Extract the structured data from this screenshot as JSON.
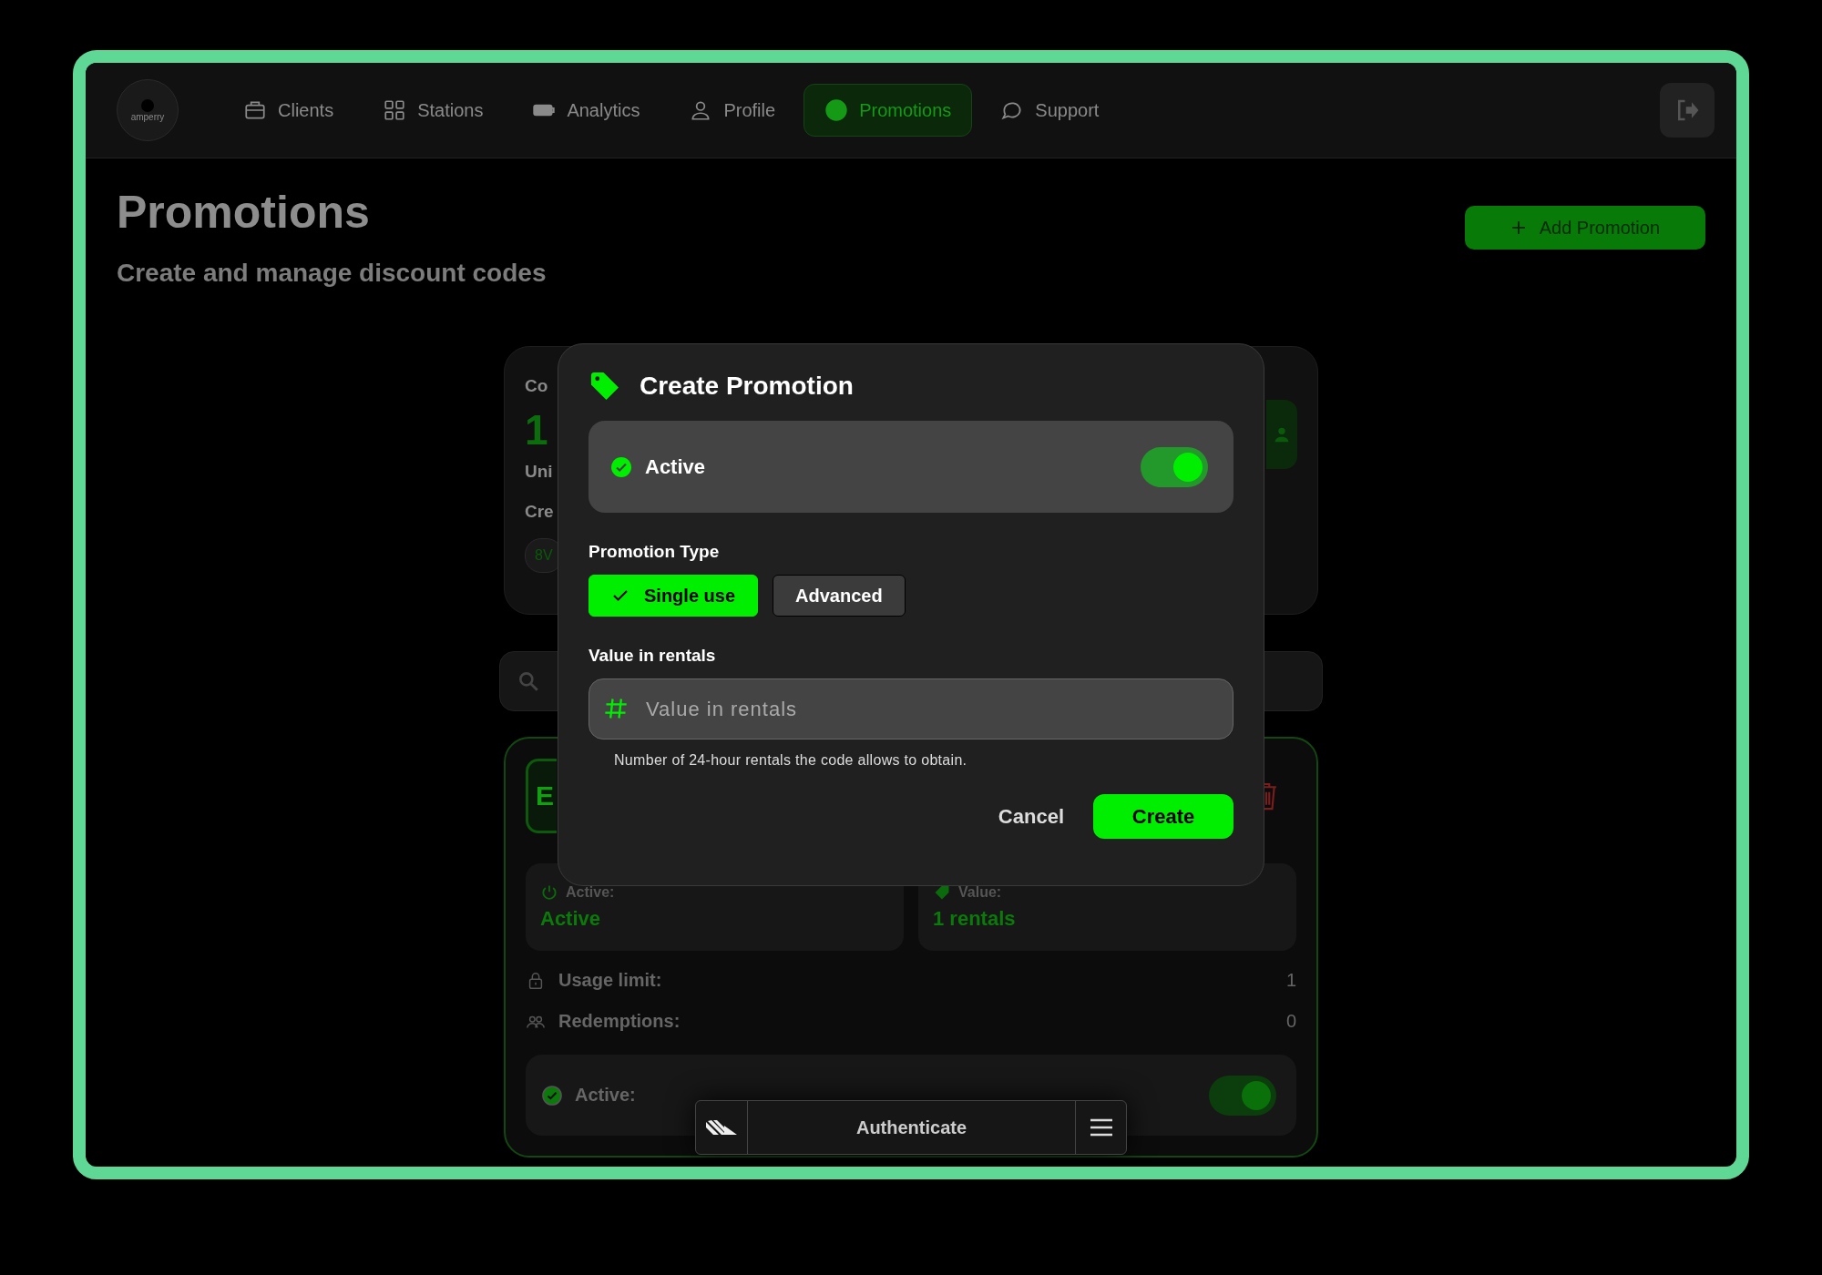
{
  "nav": {
    "logo_text": "amperry",
    "items": [
      {
        "label": "Clients",
        "selected": false
      },
      {
        "label": "Stations",
        "selected": false
      },
      {
        "label": "Analytics",
        "selected": false
      },
      {
        "label": "Profile",
        "selected": false
      },
      {
        "label": "Promotions",
        "selected": true
      },
      {
        "label": "Support",
        "selected": false
      }
    ]
  },
  "page": {
    "title": "Promotions",
    "subtitle": "Create and manage discount codes",
    "add_button": "Add Promotion"
  },
  "stats_card": {
    "heading": "Co",
    "count": "1",
    "caption": "Uni",
    "created_label": "Cre",
    "chip": "8V"
  },
  "promo_card": {
    "code_initial": "E",
    "tiles": [
      {
        "label": "Active:",
        "value": "Active"
      },
      {
        "label": "Value:",
        "value": "1 rentals"
      }
    ],
    "rows": [
      {
        "label": "Usage limit:",
        "value": "1"
      },
      {
        "label": "Redemptions:",
        "value": "0"
      }
    ],
    "active_toggle": {
      "label": "Active:",
      "on": true
    }
  },
  "modal": {
    "title": "Create Promotion",
    "active": {
      "label": "Active",
      "on": true
    },
    "type_label": "Promotion Type",
    "types": [
      {
        "label": "Single use",
        "selected": true
      },
      {
        "label": "Advanced",
        "selected": false
      }
    ],
    "value_label": "Value in rentals",
    "value_field": {
      "placeholder": "Value in rentals"
    },
    "hint": "Number of 24-hour rentals the code allows to obtain.",
    "buttons": [
      {
        "label": "Cancel",
        "kind": "text"
      },
      {
        "label": "Create",
        "kind": "primary"
      }
    ]
  },
  "auth_bar": {
    "label": "Authenticate"
  }
}
